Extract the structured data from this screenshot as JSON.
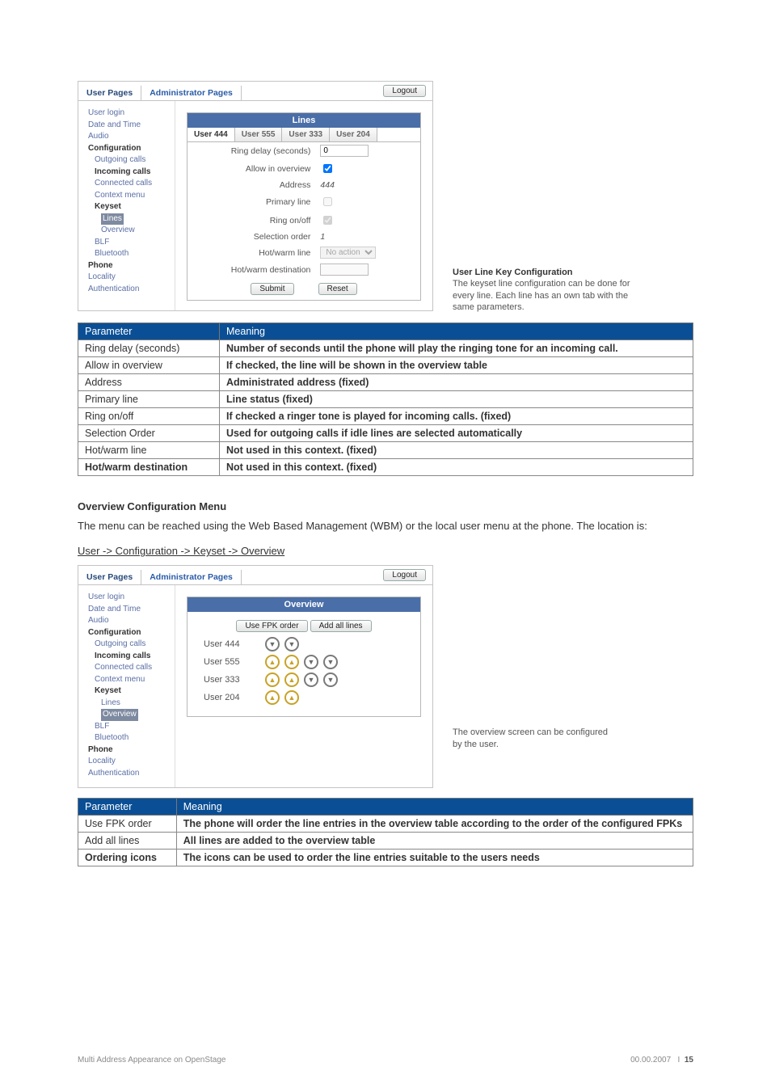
{
  "shot": {
    "tabs": {
      "user": "User Pages",
      "admin": "Administrator Pages",
      "logout": "Logout"
    },
    "nav": {
      "userlogin": "User login",
      "datetime": "Date and Time",
      "audio": "Audio",
      "config": "Configuration",
      "outgoing": "Outgoing calls",
      "incoming": "Incoming calls",
      "connected": "Connected calls",
      "context": "Context menu",
      "keyset": "Keyset",
      "lines": "Lines",
      "overview": "Overview",
      "blf": "BLF",
      "bluetooth": "Bluetooth",
      "phone": "Phone",
      "locality": "Locality",
      "auth": "Authentication"
    },
    "lines_panel": {
      "title": "Lines",
      "tabs": [
        "User 444",
        "User 555",
        "User 333",
        "User 204"
      ],
      "fields": {
        "ring_delay": "Ring delay (seconds)",
        "allow": "Allow in overview",
        "address": "Address",
        "primary": "Primary line",
        "ringonoff": "Ring on/off",
        "selorder": "Selection order",
        "hotwarm": "Hot/warm line",
        "hotwarmdest": "Hot/warm destination"
      },
      "values": {
        "ring_delay": "0",
        "address": "444",
        "selorder": "1",
        "hotwarm": "No action"
      },
      "submit": "Submit",
      "reset": "Reset"
    },
    "overview_panel": {
      "title": "Overview",
      "use_fpk": "Use FPK order",
      "add_all": "Add all lines",
      "rows": [
        "User 444",
        "User 555",
        "User 333",
        "User 204"
      ]
    }
  },
  "caption1": {
    "title": "User Line Key Configuration",
    "text": "The keyset line configuration can be done for every line. Each line has an own tab with the same parameters."
  },
  "caption2": "The overview screen can be configured by the user.",
  "table1": {
    "headers": [
      "Parameter",
      "Meaning"
    ],
    "rows": [
      [
        "Ring delay (seconds)",
        "Number of seconds until the phone will play the ringing tone for an incoming call."
      ],
      [
        "Allow in overview",
        "If checked, the line will be shown in the overview table"
      ],
      [
        "Address",
        "Administrated address (fixed)"
      ],
      [
        "Primary line",
        "Line status (fixed)"
      ],
      [
        "Ring on/off",
        "If checked a ringer tone is played for incoming calls. (fixed)"
      ],
      [
        "Selection Order",
        "Used for outgoing calls if idle lines are selected automatically"
      ],
      [
        "Hot/warm line",
        "Not used in this context. (fixed)"
      ],
      [
        "Hot/warm destination",
        "Not used in this context. (fixed)"
      ]
    ]
  },
  "section2": {
    "title": "Overview Configuration Menu",
    "body": "The menu can be reached using the Web Based Management (WBM) or the local user menu at the phone. The location is:",
    "path": "User -> Configuration -> Keyset -> Overview"
  },
  "table2": {
    "headers": [
      "Parameter",
      "Meaning"
    ],
    "rows": [
      [
        "Use FPK order",
        "The phone will order the line entries in the overview table according to the order of the configured FPKs"
      ],
      [
        "Add all lines",
        "All lines are added to the overview table"
      ],
      [
        "Ordering icons",
        "The icons can be used to order the line entries suitable to the users needs"
      ]
    ]
  },
  "footer": {
    "left": "Multi Address Appearance on OpenStage",
    "date": "00.00.2007",
    "sep": "I",
    "page": "15"
  }
}
